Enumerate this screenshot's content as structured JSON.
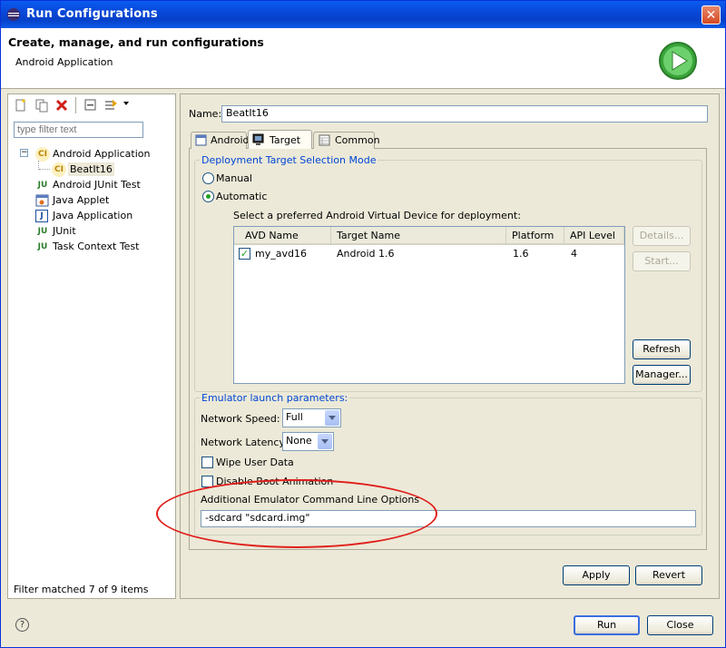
{
  "window": {
    "title": "Run Configurations",
    "close_glyph": "✕"
  },
  "header": {
    "title": "Create, manage, and run configurations",
    "subtitle": "Android Application"
  },
  "left": {
    "toolbar_icons": [
      "new-configuration-icon",
      "duplicate-icon",
      "delete-icon",
      "collapse-all-icon",
      "filter-icon"
    ],
    "filter_placeholder": "type filter text",
    "tree": [
      {
        "label": "Android Application",
        "icon": "CI",
        "expanded": true,
        "children": [
          {
            "label": "BeatIt16",
            "icon": "CI",
            "selected": true
          }
        ]
      },
      {
        "label": "Android JUnit Test",
        "icon": "JU"
      },
      {
        "label": "Java Applet",
        "icon": "applet"
      },
      {
        "label": "Java Application",
        "icon": "J"
      },
      {
        "label": "JUnit",
        "icon": "JU"
      },
      {
        "label": "Task Context Test",
        "icon": "JU"
      }
    ],
    "status": "Filter matched 7 of 9 items"
  },
  "config": {
    "name_label": "Name:",
    "name_value": "BeatIt16",
    "tabs": [
      {
        "label": "Android"
      },
      {
        "label": "Target",
        "active": true
      },
      {
        "label": "Common"
      }
    ],
    "deployment": {
      "group_label": "Deployment Target Selection Mode",
      "manual_label": "Manual",
      "automatic_label": "Automatic",
      "select_label": "Select a preferred Android Virtual Device for deployment:",
      "columns": [
        "AVD Name",
        "Target Name",
        "Platform",
        "API Level"
      ],
      "rows": [
        {
          "checked": true,
          "avd": "my_avd16",
          "target": "Android 1.6",
          "platform": "1.6",
          "api": "4"
        }
      ],
      "buttons": {
        "details": "Details...",
        "start": "Start...",
        "refresh": "Refresh",
        "manager": "Manager..."
      }
    },
    "emulator": {
      "group_label": "Emulator launch parameters:",
      "network_speed_label": "Network Speed:",
      "network_speed_value": "Full",
      "network_latency_label": "Network Latency:",
      "network_latency_value": "None",
      "wipe_label": "Wipe User Data",
      "disable_boot_label": "Disable Boot Animation",
      "options_label": "Additional Emulator Command Line Options",
      "options_value": "-sdcard \"sdcard.img\""
    },
    "apply_label": "Apply",
    "revert_label": "Revert"
  },
  "footer": {
    "run_label": "Run",
    "close_label": "Close",
    "help_glyph": "?"
  },
  "colors": {
    "title_bar": "#0a5cf0",
    "highlight": "#e0201c",
    "group_label": "#0046d5"
  }
}
